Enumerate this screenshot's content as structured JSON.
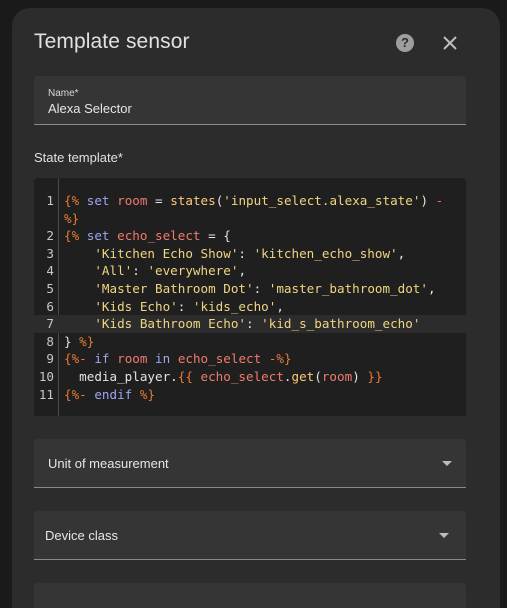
{
  "dialog": {
    "title": "Template sensor",
    "help_icon": "help-circle-icon",
    "close_icon": "close-icon"
  },
  "name_field": {
    "label": "Name*",
    "value": "Alexa Selector"
  },
  "state_template": {
    "label": "State template*",
    "line_numbers": [
      "1",
      "2",
      "3",
      "4",
      "5",
      "6",
      "7",
      "8",
      "9",
      "10",
      "11"
    ]
  },
  "unit_field": {
    "label": "Unit of measurement"
  },
  "device_class_field": {
    "label": "Device class"
  },
  "colors": {
    "delimiter": "#e87b35",
    "keyword": "#9ba6f0",
    "variable": "#f07b6e",
    "string": "#efd582",
    "dialog_bg": "#2c2c2c",
    "editor_bg": "#1f1f1f"
  }
}
